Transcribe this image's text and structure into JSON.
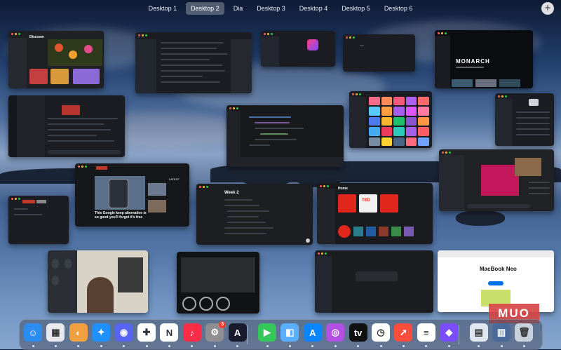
{
  "spaces": {
    "tabs": [
      {
        "label": "Desktop 1",
        "active": false
      },
      {
        "label": "Desktop 2",
        "active": true
      },
      {
        "label": "Dia",
        "active": false
      },
      {
        "label": "Desktop 3",
        "active": false
      },
      {
        "label": "Desktop 4",
        "active": false
      },
      {
        "label": "Desktop 5",
        "active": false
      },
      {
        "label": "Desktop 6",
        "active": false
      }
    ],
    "add_label": "+"
  },
  "windows": {
    "discover": {
      "title": "Discover"
    },
    "tv": {
      "headline": "MONARCH"
    },
    "browser": {
      "headline": "This Google keep alternative is so good you'll forget it's free",
      "badge": "LATEST"
    },
    "notes": {
      "title": "Week 2"
    },
    "music": {
      "title": "Home",
      "cards": [
        "TED",
        "TED TALKS DAILY",
        "TED"
      ]
    },
    "safari": {
      "product": "MacBook Neo"
    }
  },
  "dock": {
    "items": [
      {
        "name": "finder-icon",
        "glyph": "☺",
        "color": "#2d8cf0"
      },
      {
        "name": "launchpad-icon",
        "glyph": "▦",
        "color": "#e8e8ee"
      },
      {
        "name": "preview-icon",
        "glyph": "◐",
        "color": "#f0a040"
      },
      {
        "name": "safari-icon",
        "glyph": "✦",
        "color": "#1e90ff"
      },
      {
        "name": "discord-icon",
        "glyph": "◉",
        "color": "#5865f2"
      },
      {
        "name": "slack-icon",
        "glyph": "✚",
        "color": "#ffffff"
      },
      {
        "name": "notion-icon",
        "glyph": "N",
        "color": "#ffffff"
      },
      {
        "name": "music-icon",
        "glyph": "♪",
        "color": "#fa2d48"
      },
      {
        "name": "system-settings-icon",
        "glyph": "⚙",
        "color": "#8e8e93",
        "badge": "3"
      },
      {
        "name": "arc-browser-icon",
        "glyph": "A",
        "color": "#1a1a2e"
      },
      {
        "name": "facetime-icon",
        "glyph": "▶",
        "color": "#34c759"
      },
      {
        "name": "finder-alt-icon",
        "glyph": "◧",
        "color": "#5ab0ff"
      },
      {
        "name": "app-store-icon",
        "glyph": "A",
        "color": "#0a84ff"
      },
      {
        "name": "podcasts-icon",
        "glyph": "◎",
        "color": "#b150e2"
      },
      {
        "name": "apple-tv-icon",
        "glyph": "tv",
        "color": "#111111"
      },
      {
        "name": "clock-icon",
        "glyph": "◷",
        "color": "#ffffff"
      },
      {
        "name": "rocket-icon",
        "glyph": "➚",
        "color": "#ff4d3d"
      },
      {
        "name": "reminders-icon",
        "glyph": "≡",
        "color": "#ffffff"
      },
      {
        "name": "shortcuts-icon",
        "glyph": "◆",
        "color": "#7b4dff"
      },
      {
        "name": "downloads-stack-icon",
        "glyph": "▤",
        "color": "#dfe6ef"
      },
      {
        "name": "folder-stack-icon",
        "glyph": "▥",
        "color": "#4a6a9a"
      },
      {
        "name": "trash-icon",
        "glyph": "🗑",
        "color": "#c9d2dc"
      }
    ]
  },
  "watermark": {
    "text": "MUO"
  }
}
